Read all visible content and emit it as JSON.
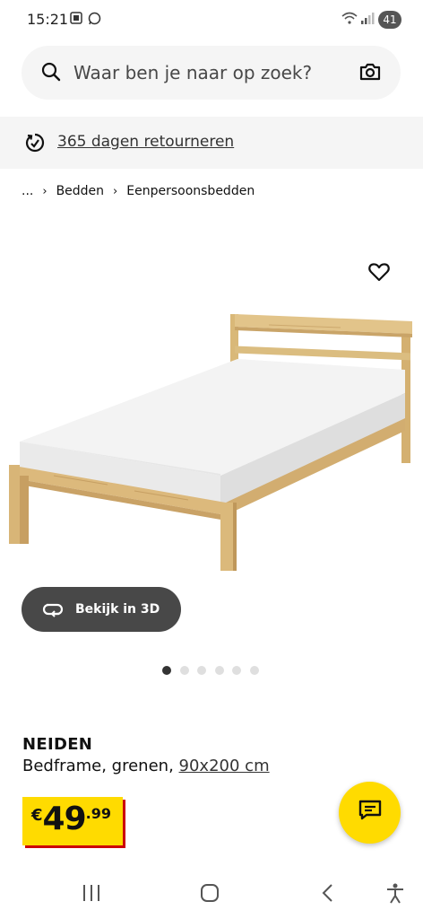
{
  "status_bar": {
    "time": "15:21",
    "battery": "41"
  },
  "search": {
    "placeholder": "Waar ben je naar op zoek?"
  },
  "return_banner": {
    "label": "365 dagen retourneren"
  },
  "breadcrumb": {
    "ellipsis": "...",
    "items": [
      "Bedden",
      "Eenpersoonsbedden"
    ]
  },
  "gallery": {
    "view3d_label": "Bekijk in 3D",
    "total_images": 6,
    "active_index": 0
  },
  "product": {
    "name": "NEIDEN",
    "description": "Bedframe, grenen,",
    "size": "90x200 cm",
    "price": {
      "currency": "€",
      "integer": "49",
      "decimal": ".99"
    }
  },
  "colors": {
    "brand_yellow": "#ffdb00",
    "price_shadow": "#cc0008",
    "button_dark": "#484848"
  },
  "icons": {
    "search": "search-icon",
    "camera": "camera-icon",
    "return": "return-icon",
    "favorite": "heart-icon",
    "view3d": "rotate-icon",
    "chat": "chat-icon"
  }
}
